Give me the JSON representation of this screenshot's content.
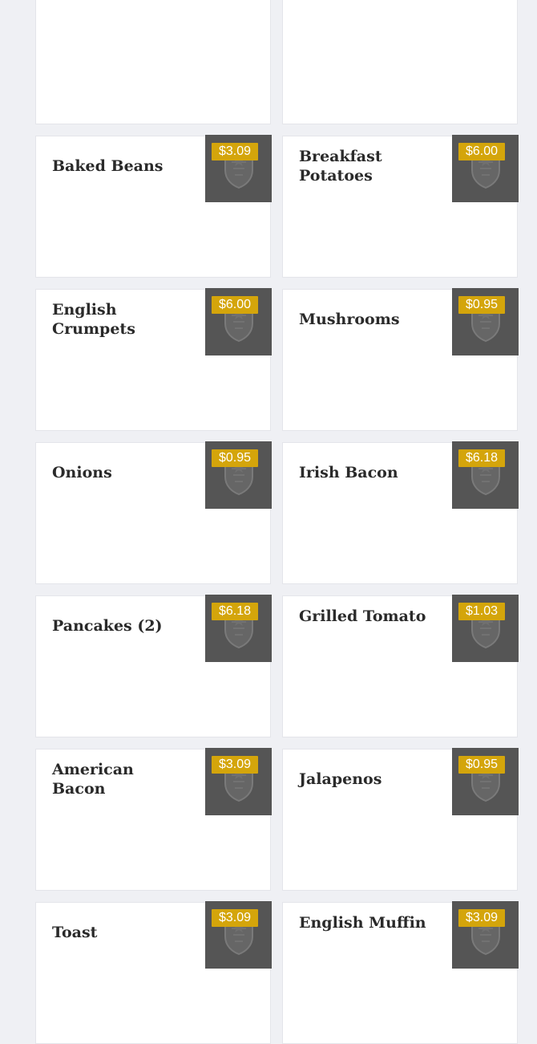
{
  "accent_color": "#d4a50b",
  "placeholder_icon": "crest-shield-icon",
  "menu": {
    "items": [
      {
        "name": "",
        "price": "",
        "empty": true
      },
      {
        "name": "",
        "price": "",
        "empty": true
      },
      {
        "name": "Baked Beans",
        "price": "$3.09"
      },
      {
        "name": "Breakfast Potatoes",
        "price": "$6.00"
      },
      {
        "name": "English Crumpets",
        "price": "$6.00"
      },
      {
        "name": "Mushrooms",
        "price": "$0.95"
      },
      {
        "name": "Onions",
        "price": "$0.95"
      },
      {
        "name": "Irish Bacon",
        "price": "$6.18"
      },
      {
        "name": "Pancakes (2)",
        "price": "$6.18"
      },
      {
        "name": "Grilled Tomato",
        "price": "$1.03"
      },
      {
        "name": "American Bacon",
        "price": "$3.09"
      },
      {
        "name": "Jalapenos",
        "price": "$0.95"
      },
      {
        "name": "Toast",
        "price": "$3.09"
      },
      {
        "name": "English Muffin",
        "price": "$3.09"
      }
    ]
  }
}
